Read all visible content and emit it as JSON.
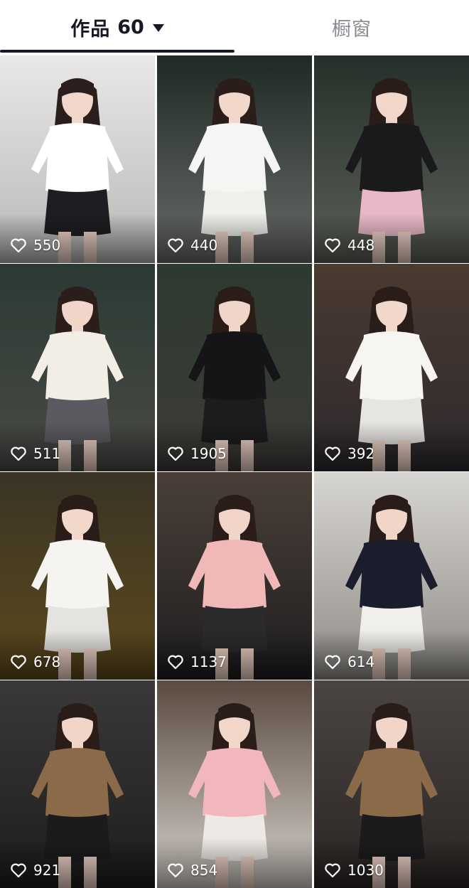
{
  "tabs": {
    "works_label": "作品",
    "works_count": "60",
    "shop_label": "橱窗"
  },
  "videos": [
    {
      "likes": "550",
      "bg": [
        "#e9e8e6",
        "#b9b8b6"
      ],
      "top": "#ffffff",
      "bottom": "#1e1e22",
      "hair": "#2a1f1c",
      "skin": "#f1d6c9"
    },
    {
      "likes": "440",
      "bg": [
        "#1f2a24",
        "#6a6c6a"
      ],
      "top": "#f5f5f3",
      "bottom": "#efefec",
      "hair": "#2b1d19",
      "skin": "#f2d7cb"
    },
    {
      "likes": "448",
      "bg": [
        "#25302a",
        "#5c5f58"
      ],
      "top": "#1a1a1c",
      "bottom": "#e8b8c8",
      "hair": "#2a1c18",
      "skin": "#f2d6ca"
    },
    {
      "likes": "511",
      "bg": [
        "#2b3a33",
        "#4a4a46"
      ],
      "top": "#f3eee5",
      "bottom": "#5a5a60",
      "hair": "#2a1d1a",
      "skin": "#f0d5c8"
    },
    {
      "likes": "1905",
      "bg": [
        "#2d3a30",
        "#3d3b38"
      ],
      "top": "#151517",
      "bottom": "#1c1c1e",
      "hair": "#2b1c18",
      "skin": "#f1d5c8"
    },
    {
      "likes": "392",
      "bg": [
        "#4a3a30",
        "#2e2a2e"
      ],
      "top": "#f7f5f2",
      "bottom": "#e7e5e2",
      "hair": "#2a1c18",
      "skin": "#f2d7cb"
    },
    {
      "likes": "678",
      "bg": [
        "#3a3426",
        "#5d4a1c"
      ],
      "top": "#f6f4f0",
      "bottom": "#e5e3df",
      "hair": "#2a1c18",
      "skin": "#f2d7cb"
    },
    {
      "likes": "1137",
      "bg": [
        "#4a3f38",
        "#1f1e20"
      ],
      "top": "#f0b9b8",
      "bottom": "#2b2a2c",
      "hair": "#2a1c18",
      "skin": "#f2d5c8"
    },
    {
      "likes": "614",
      "bg": [
        "#d8d6d2",
        "#8f8c88"
      ],
      "top": "#1b1d2c",
      "bottom": "#f1efec",
      "hair": "#2a1c18",
      "skin": "#f1d5c8"
    },
    {
      "likes": "921",
      "bg": [
        "#3a3838",
        "#1e1d1e"
      ],
      "top": "#8a6a48",
      "bottom": "#1b1b1d",
      "hair": "#2a1c18",
      "skin": "#f1d5c8"
    },
    {
      "likes": "854",
      "bg": [
        "#5a4a40",
        "#d6d2cc"
      ],
      "top": "#f2b6bd",
      "bottom": "#ede9e5",
      "hair": "#2a1c18",
      "skin": "#f2d6ca"
    },
    {
      "likes": "1030",
      "bg": [
        "#4a4442",
        "#2a2624"
      ],
      "top": "#8a6a48",
      "bottom": "#1b1b1d",
      "hair": "#2a1c18",
      "skin": "#f1d5c8"
    }
  ]
}
